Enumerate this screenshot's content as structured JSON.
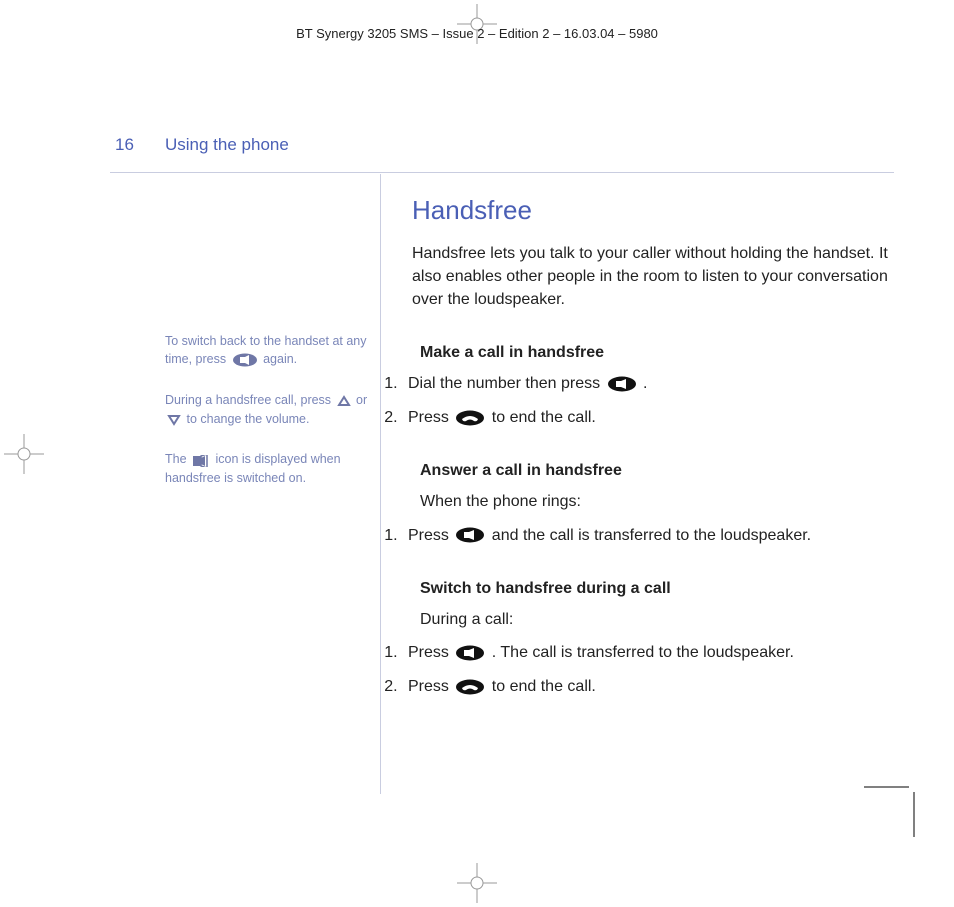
{
  "print_header": "BT Synergy 3205 SMS – Issue 2 – Edition 2 – 16.03.04 – 5980",
  "page_number": "16",
  "section": "Using the phone",
  "side": {
    "tip1_a": "To switch back to the handset at any time, press ",
    "tip1_b": " again.",
    "tip2_a": "During a handsfree call, press ",
    "tip2_b": " or ",
    "tip2_c": " to change the volume.",
    "tip3_a": "The ",
    "tip3_b": " icon is displayed when handsfree is switched on."
  },
  "main": {
    "h1": "Handsfree",
    "intro": "Handsfree lets you talk to your caller without holding the handset. It also enables other people in the room to listen to your conversation over the loudspeaker.",
    "sub1": "Make a call in handsfree",
    "s1_1a": "Dial the number then press ",
    "s1_1b": ".",
    "s1_2a": "Press ",
    "s1_2b": " to end the call.",
    "sub2": "Answer a call in handsfree",
    "s2_pre": "When the phone rings:",
    "s2_1a": "Press ",
    "s2_1b": " and the call is transferred to the loudspeaker.",
    "sub3": "Switch to handsfree during a call",
    "s3_pre": "During a call:",
    "s3_1a": "Press ",
    "s3_1b": ". The call is transferred to the loudspeaker.",
    "s3_2a": "Press ",
    "s3_2b": " to end the call."
  }
}
